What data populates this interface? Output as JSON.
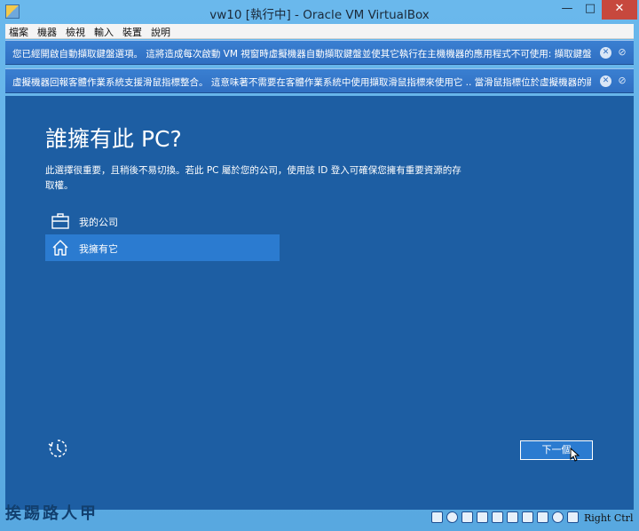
{
  "window": {
    "title": "vw10 [執行中] - Oracle VM VirtualBox",
    "minimize_glyph": "—",
    "maximize_glyph": "□",
    "close_glyph": "✕"
  },
  "menu": [
    "檔案",
    "機器",
    "檢視",
    "輸入",
    "裝置",
    "說明"
  ],
  "notices": [
    {
      "text": "您已經開啟自動擷取鍵盤選項。 這將造成每次啟動 VM 視窗時虛擬機器自動擷取鍵盤並使其它執行在主機機器的應用程式不可使用: 擷取鍵盤"
    },
    {
      "text": "虛擬機器回報客體作業系統支援滑鼠指標整合。 這意味著不需要在客體作業系統中使用擷取滑鼠指標來使用它 .. 當滑鼠指標位於虛擬機器的顯"
    }
  ],
  "setup": {
    "title": "誰擁有此 PC?",
    "description": "此選擇很重要，且稍後不易切換。若此 PC 屬於您的公司，使用該 ID 登入可確保您擁有重要資源的存取權。",
    "options": [
      {
        "label": "我的公司",
        "icon": "briefcase-icon"
      },
      {
        "label": "我擁有它",
        "icon": "home-icon"
      }
    ],
    "next_label": "下一個"
  },
  "statusbar": {
    "watermark": "挨踢路人甲",
    "host_key": "Right Ctrl"
  },
  "colors": {
    "guest_bg": "#1d5ea3",
    "selection": "#2b7bd0",
    "notice_bg": "#2f6fc2"
  }
}
